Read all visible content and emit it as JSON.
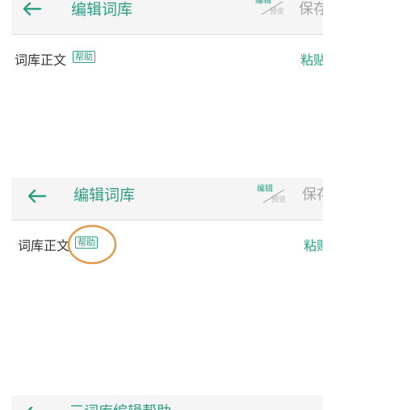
{
  "screens": [
    {
      "title": "编辑词库",
      "mode_toggle": {
        "top": "编辑",
        "bottom": "预览"
      },
      "save_label": "保存",
      "body_label": "词库正文",
      "help_tag": "帮助",
      "paste_label": "粘贴"
    },
    {
      "title": "编辑词库",
      "mode_toggle": {
        "top": "编辑",
        "bottom": "预览"
      },
      "save_label": "保存",
      "body_label": "词库正文",
      "help_tag": "帮助",
      "paste_label": "粘贴"
    },
    {
      "title": "三词库编辑帮助"
    }
  ],
  "colors": {
    "accent": "#2e9e83",
    "header_bg": "#f5f5f5",
    "annotation": "#e09a4a",
    "muted": "#a3a3a3"
  },
  "icons": {
    "back": "arrow-left-icon",
    "annotation": "highlight-circle"
  }
}
